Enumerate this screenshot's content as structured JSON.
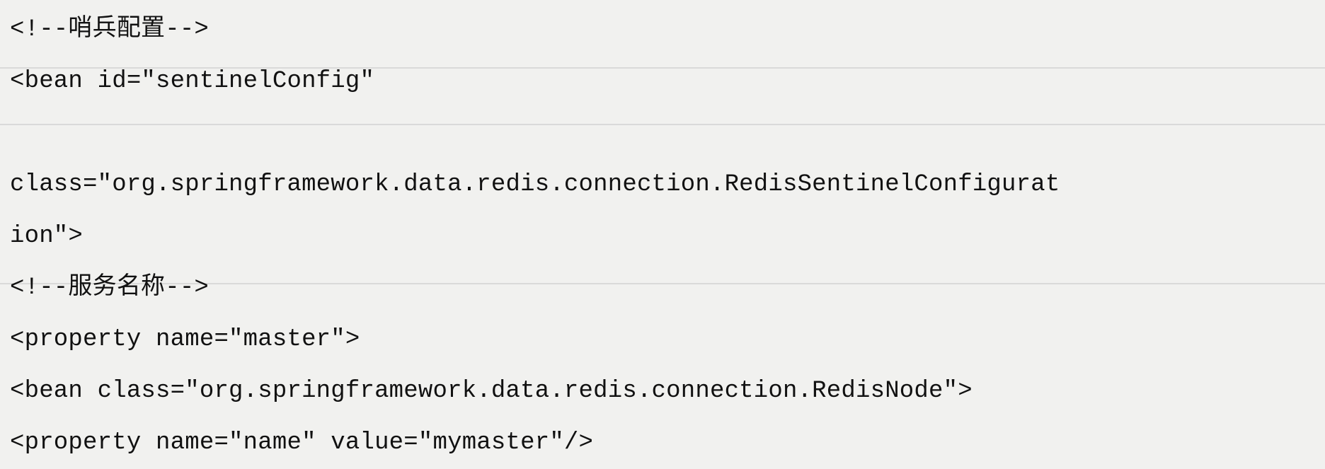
{
  "code_lines": [
    "<!--哨兵配置-->",
    "<bean id=\"sentinelConfig\"",
    "",
    "class=\"org.springframework.data.redis.connection.RedisSentinelConfigurat",
    "ion\">",
    "<!--服务名称-->",
    "<property name=\"master\">",
    "<bean class=\"org.springframework.data.redis.connection.RedisNode\">",
    "<property name=\"name\" value=\"mymaster\"/>"
  ]
}
